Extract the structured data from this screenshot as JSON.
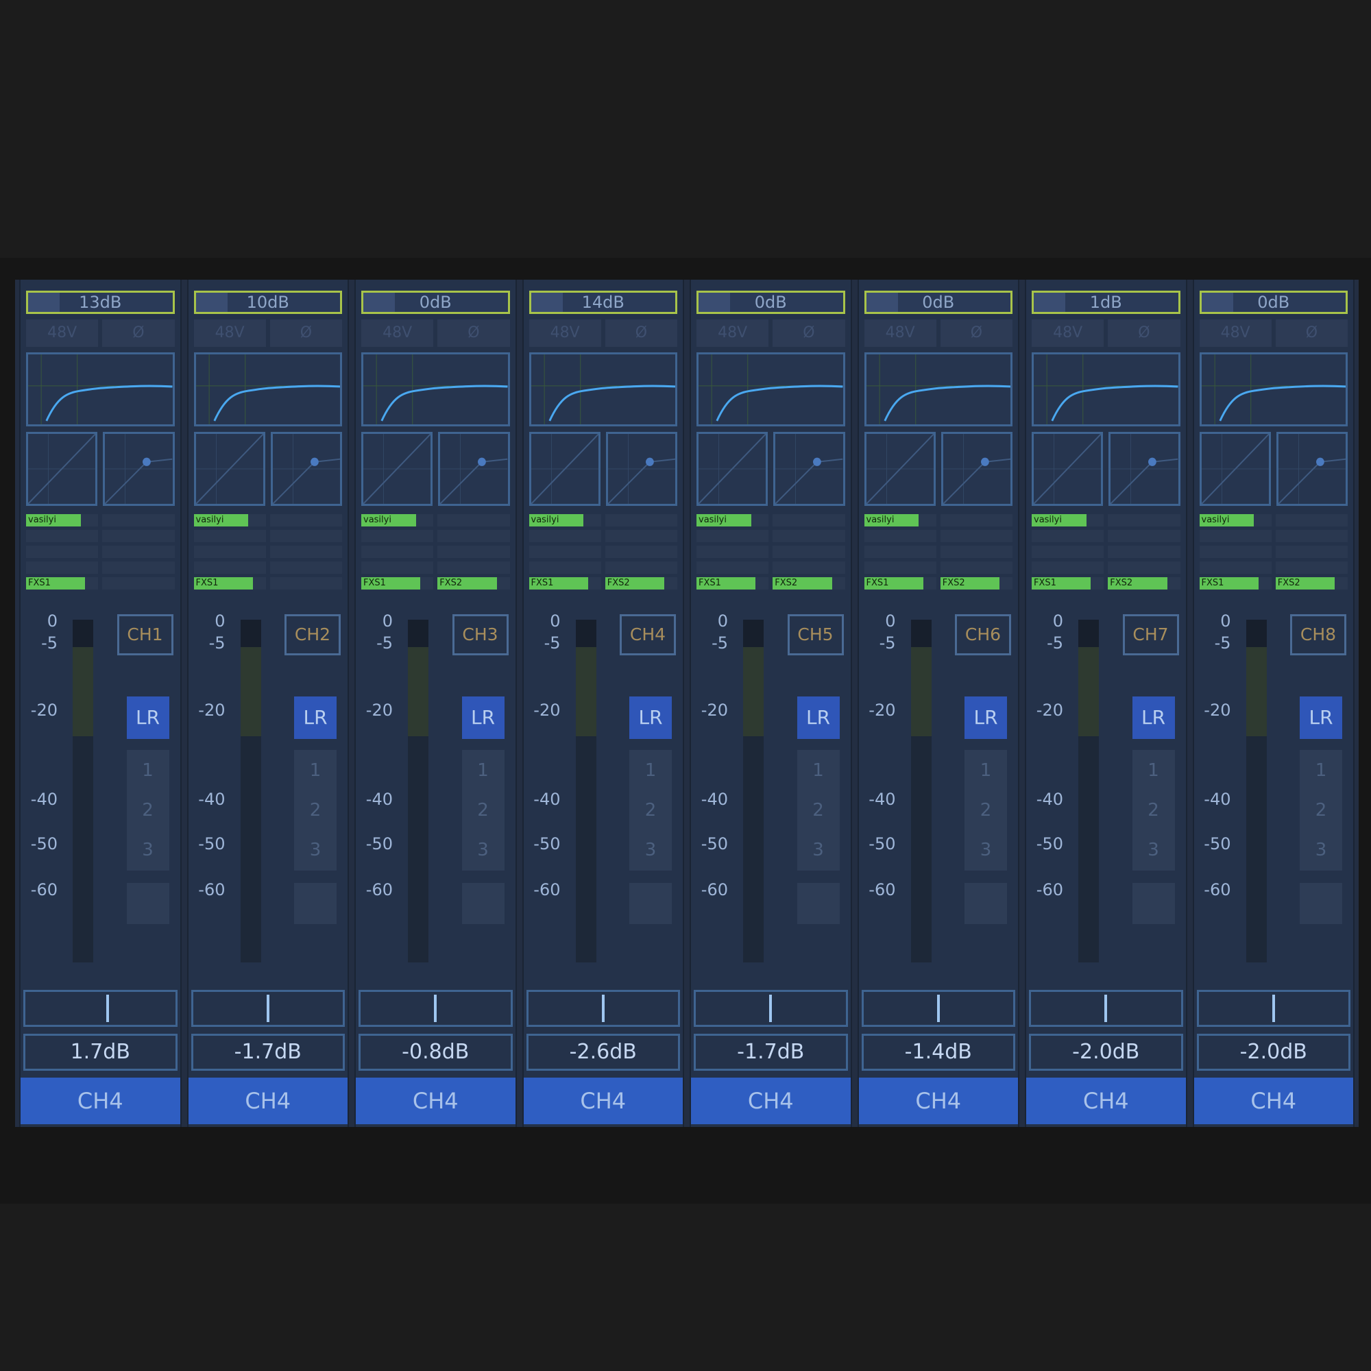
{
  "scale_labels": [
    "0",
    "-5",
    "-20",
    "-40",
    "-50",
    "-60"
  ],
  "toggle_labels": [
    "48V",
    "Ø"
  ],
  "bus_labels": [
    "1",
    "2",
    "3",
    ""
  ],
  "lr_label": "LR",
  "strips": [
    {
      "gain": "13dB",
      "channel": "CH1",
      "fader_value": "1.7dB",
      "name": "CH4",
      "pan_position": 0.55,
      "send_tag": "vasilyi",
      "fx1": "FXS1",
      "fx2": ""
    },
    {
      "gain": "10dB",
      "channel": "CH2",
      "fader_value": "-1.7dB",
      "name": "CH4",
      "pan_position": 0.5,
      "send_tag": "vasilyi",
      "fx1": "FXS1",
      "fx2": ""
    },
    {
      "gain": "0dB",
      "channel": "CH3",
      "fader_value": "-0.8dB",
      "name": "CH4",
      "pan_position": 0.5,
      "send_tag": "vasilyi",
      "fx1": "FXS1",
      "fx2": "FXS2"
    },
    {
      "gain": "14dB",
      "channel": "CH4",
      "fader_value": "-2.6dB",
      "name": "CH4",
      "pan_position": 0.5,
      "send_tag": "vasilyi",
      "fx1": "FXS1",
      "fx2": "FXS2"
    },
    {
      "gain": "0dB",
      "channel": "CH5",
      "fader_value": "-1.7dB",
      "name": "CH4",
      "pan_position": 0.5,
      "send_tag": "vasilyi",
      "fx1": "FXS1",
      "fx2": "FXS2"
    },
    {
      "gain": "0dB",
      "channel": "CH6",
      "fader_value": "-1.4dB",
      "name": "CH4",
      "pan_position": 0.5,
      "send_tag": "vasilyi",
      "fx1": "FXS1",
      "fx2": "FXS2"
    },
    {
      "gain": "1dB",
      "channel": "CH7",
      "fader_value": "-2.0dB",
      "name": "CH4",
      "pan_position": 0.5,
      "send_tag": "vasilyi",
      "fx1": "FXS1",
      "fx2": "FXS2"
    },
    {
      "gain": "0dB",
      "channel": "CH8",
      "fader_value": "-2.0dB",
      "name": "CH4",
      "pan_position": 0.5,
      "send_tag": "vasilyi",
      "fx1": "FXS1",
      "fx2": "FXS2"
    }
  ],
  "colors": {
    "gain_border": "#a8c44a",
    "eq_curve": "#4aa8f0",
    "send_tag": "#5fc455",
    "lr_button": "#2f56b8",
    "name_bar": "#2f5ec2",
    "channel_label": "#a88e5c"
  }
}
